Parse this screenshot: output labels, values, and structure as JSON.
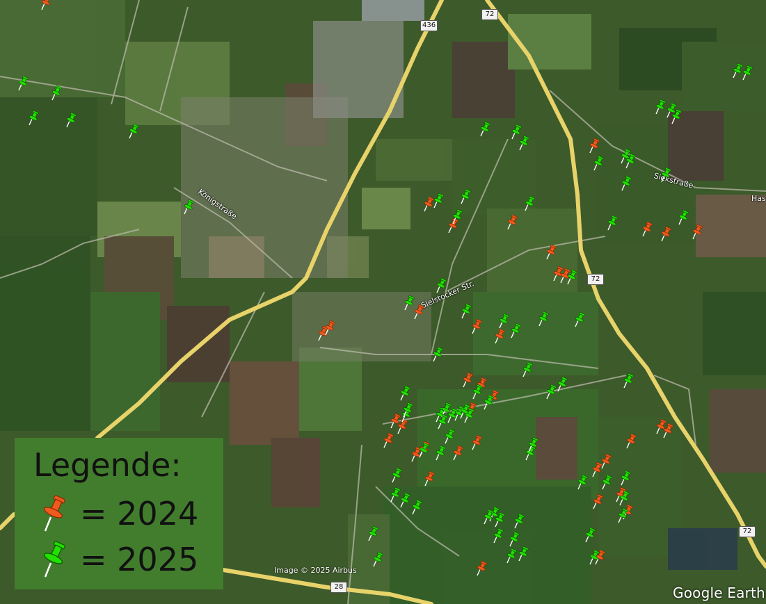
{
  "legend": {
    "title": "Legende:",
    "items": [
      {
        "year": "= 2024",
        "color": "#f05a1e"
      },
      {
        "year": "= 2025",
        "color": "#22e000"
      }
    ]
  },
  "attribution": "Image © 2025 Airbus",
  "brand": "Google Earth",
  "road_labels": [
    "436",
    "72",
    "72",
    "72",
    "28"
  ],
  "street_labels": [
    "Königstraße",
    "Sielstocker Str.",
    "Siekstraße",
    "Has"
  ],
  "colors": {
    "pin_2024": "#f05a1e",
    "pin_2025": "#22e000",
    "road": "#e8d36a"
  }
}
